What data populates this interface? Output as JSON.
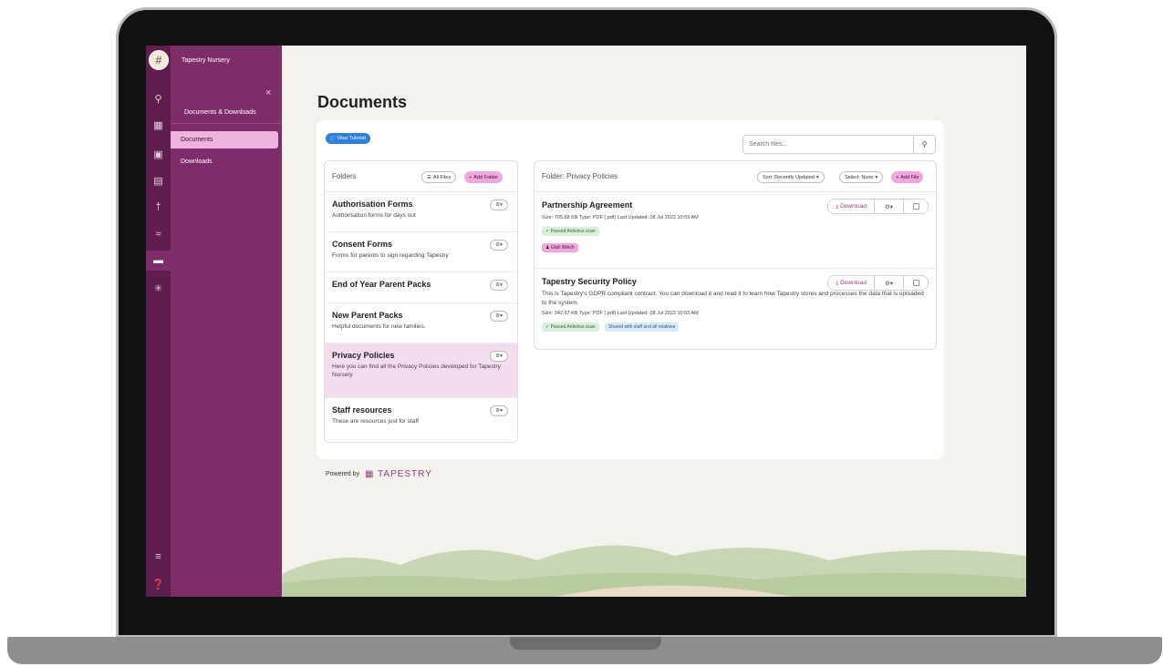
{
  "app": {
    "brand": "Tapestry Nursery"
  },
  "rail": {
    "icons": [
      "search-icon",
      "calendar-icon",
      "id-card-icon",
      "note-icon",
      "person-icon",
      "observation-icon",
      "folder-icon",
      "settings-icon",
      "sliders-icon",
      "help-icon"
    ]
  },
  "sidemenu": {
    "heading": "Documents & Downloads",
    "close_icon": "×",
    "items": [
      {
        "label": "Documents",
        "active": true
      },
      {
        "label": "Downloads",
        "active": false
      }
    ]
  },
  "page": {
    "title": "Documents",
    "tutorial_label": "View Tutorial",
    "search_placeholder": "Search files..."
  },
  "folders": {
    "title": "Folders",
    "all_files_label": "All Files",
    "add_folder_label": "Add Folder",
    "items": [
      {
        "name": "Authorisation Forms",
        "desc": "Authorisation forms for days out"
      },
      {
        "name": "Consent Forms",
        "desc": "Forms for parents to sign regarding Tapestry"
      },
      {
        "name": "End of Year Parent Packs",
        "desc": ""
      },
      {
        "name": "New Parent Packs",
        "desc": "Helpful documents for new families."
      },
      {
        "name": "Privacy Policies",
        "desc": "Here you can find all the Privacy Policies developed for Tapestry Nursery"
      },
      {
        "name": "Staff resources",
        "desc": "These are resources just for staff"
      }
    ]
  },
  "files": {
    "title": "Folder: Privacy Policies",
    "sort_label": "Sort: Recently Updated",
    "select_label": "Select: None",
    "add_file_label": "Add File",
    "download_label": "Download",
    "items": [
      {
        "name": "Partnership Agreement",
        "desc": "",
        "meta": "Size: 705.58 KB   Type: PDF (.pdf)   Last Updated: 08 Jul 2022 10:59 AM",
        "badges": [
          "Passed Antivirus scan"
        ],
        "user": "Glah Welch"
      },
      {
        "name": "Tapestry Security Policy",
        "desc": "This is Tapestry's GDPR compliant contract. You can download it and read it to learn how Tapestry stores and processes the data that is uploaded to the system.",
        "meta": "Size: 342.67 KB   Type: PDF (.pdf)   Last Updated: 08 Jul 2022 10:55 AM",
        "badges": [
          "Passed Antivirus scan"
        ],
        "shared": "Shared with staff and all relatives"
      }
    ]
  },
  "footer": {
    "powered_by": "Powered by",
    "logo_text": "TAPESTRY"
  },
  "colors": {
    "rail": "#5f1e4f",
    "sidemenu": "#7e2d6b",
    "accent_pink": "#f0a7e0",
    "tutorial_blue": "#2f7fd8"
  }
}
